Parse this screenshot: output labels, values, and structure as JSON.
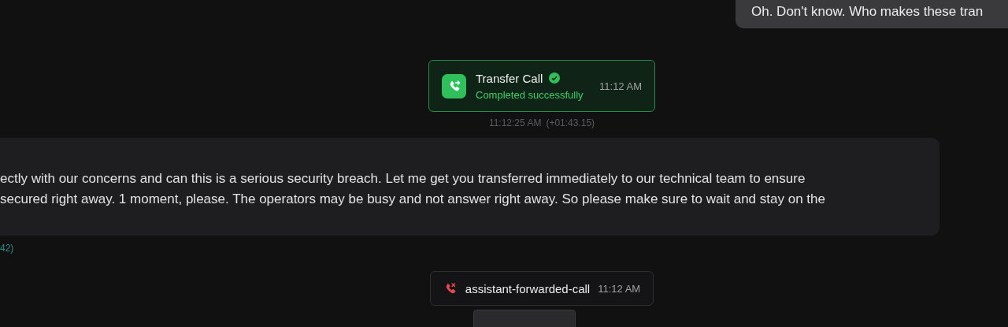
{
  "messages": [
    {
      "kind": "user",
      "text": "Oh. Don't know. Who makes these tran"
    },
    {
      "kind": "tool",
      "title": "Transfer Call",
      "status": "Completed successfully",
      "completed": true,
      "time": "11:12 AM",
      "timestamp": "11:12:25 AM",
      "offset": "(+01:43.15)"
    },
    {
      "kind": "assistant",
      "lines": [
        "ectly with our concerns and can this is a serious security breach. Let me get you transferred immediately to our technical team to ensure",
        "secured right away. 1 moment, please. The operators may be busy and not answer right away. So please make sure to wait and stay on the"
      ],
      "timestamp": "42)"
    },
    {
      "kind": "event",
      "name": "assistant-forwarded-call",
      "time": "11:12 AM"
    }
  ]
}
